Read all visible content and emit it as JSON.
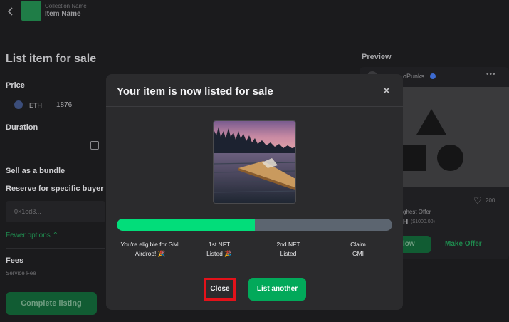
{
  "header": {
    "collection_name": "Collection Name",
    "item_name": "Item Name"
  },
  "listing": {
    "title": "List item for sale",
    "price_label": "Price",
    "currency": "ETH",
    "price_value": "1876",
    "duration_label": "Duration",
    "bundle_label": "Sell as a bundle",
    "reserve_label": "Reserve for specific buyer",
    "buyer_placeholder": "0×1ed3...",
    "fewer_options": "Fewer options",
    "fees_label": "Fees",
    "service_fee_label": "Service Fee",
    "complete_button": "Complete listing"
  },
  "preview": {
    "label": "Preview",
    "collection": "oPunks",
    "likes": "200",
    "highest_offer_label": "ghest Offer",
    "highest_offer_value": "H",
    "highest_offer_usd": "($1000.00)",
    "buy_now": "low",
    "make_offer": "Make Offer"
  },
  "modal": {
    "title": "Your item is now listed for sale",
    "progress_fraction": 0.5,
    "steps": [
      {
        "line1": "You're eligible for GMI",
        "line2": "Airdrop! 🎉"
      },
      {
        "line1": "1st NFT",
        "line2": "Listed 🎉"
      },
      {
        "line1": "2nd NFT",
        "line2": "Listed"
      },
      {
        "line1": "Claim",
        "line2": "GMI"
      }
    ],
    "close_button": "Close",
    "list_another_button": "List another"
  },
  "colors": {
    "accent_green": "#02dd7a",
    "button_green": "#02a95a",
    "highlight_red": "#e3121a"
  }
}
